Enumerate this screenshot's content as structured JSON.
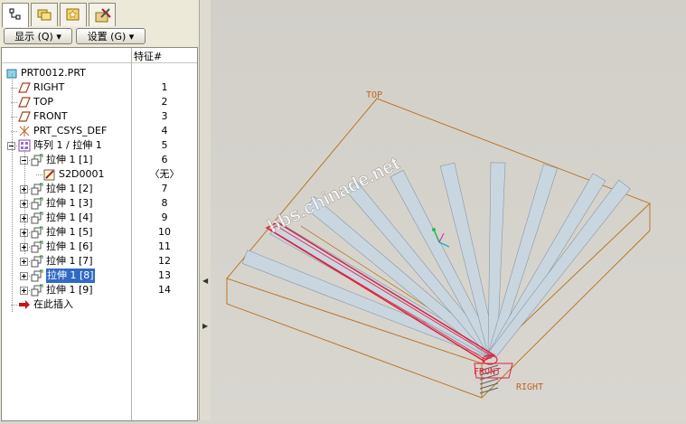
{
  "tabs": [
    {
      "name": "model-tree-tab",
      "icon": "model-tree-icon",
      "active": true
    },
    {
      "name": "folder-browser-tab",
      "icon": "folder-icon",
      "active": false
    },
    {
      "name": "favorites-tab",
      "icon": "favorites-icon",
      "active": false
    },
    {
      "name": "tools-tab",
      "icon": "tools-icon",
      "active": false
    }
  ],
  "toolbar": {
    "show_label": "显示 (Q) ▾",
    "settings_label": "设置 (G) ▾"
  },
  "tree": {
    "column_header": "特征#",
    "rows": [
      {
        "label": "PRT0012.PRT",
        "num": "",
        "icon": "part-icon"
      },
      {
        "label": "RIGHT",
        "num": "1",
        "icon": "datum-plane-icon"
      },
      {
        "label": "TOP",
        "num": "2",
        "icon": "datum-plane-icon"
      },
      {
        "label": "FRONT",
        "num": "3",
        "icon": "datum-plane-icon"
      },
      {
        "label": "PRT_CSYS_DEF",
        "num": "4",
        "icon": "coordinate-system-icon"
      },
      {
        "label": "阵列 1 / 拉伸 1",
        "num": "5",
        "icon": "pattern-icon"
      },
      {
        "label": "拉伸 1 [1]",
        "num": "6",
        "icon": "extrude-icon"
      },
      {
        "label": "S2D0001",
        "num": "〈无〉",
        "icon": "sketch-icon"
      },
      {
        "label": "拉伸 1 [2]",
        "num": "7",
        "icon": "extrude-icon"
      },
      {
        "label": "拉伸 1 [3]",
        "num": "8",
        "icon": "extrude-icon"
      },
      {
        "label": "拉伸 1 [4]",
        "num": "9",
        "icon": "extrude-icon"
      },
      {
        "label": "拉伸 1 [5]",
        "num": "10",
        "icon": "extrude-icon"
      },
      {
        "label": "拉伸 1 [6]",
        "num": "11",
        "icon": "extrude-icon"
      },
      {
        "label": "拉伸 1 [7]",
        "num": "12",
        "icon": "extrude-icon"
      },
      {
        "label": "拉伸 1 [8]",
        "num": "13",
        "icon": "extrude-icon",
        "selected": true
      },
      {
        "label": "拉伸 1 [9]",
        "num": "14",
        "icon": "extrude-icon"
      },
      {
        "label": "在此插入",
        "num": "",
        "icon": "insert-here-arrow-icon"
      }
    ]
  },
  "viewport": {
    "plane_labels": {
      "top": "TOP",
      "front": "FRONT",
      "right": "RIGHT"
    },
    "watermark": "bbs.chinade.net",
    "colors": {
      "datum": "#b8782a",
      "highlight": "#e0203c",
      "blade": "#c9d6e0",
      "blade_edge": "#8797a5"
    }
  }
}
